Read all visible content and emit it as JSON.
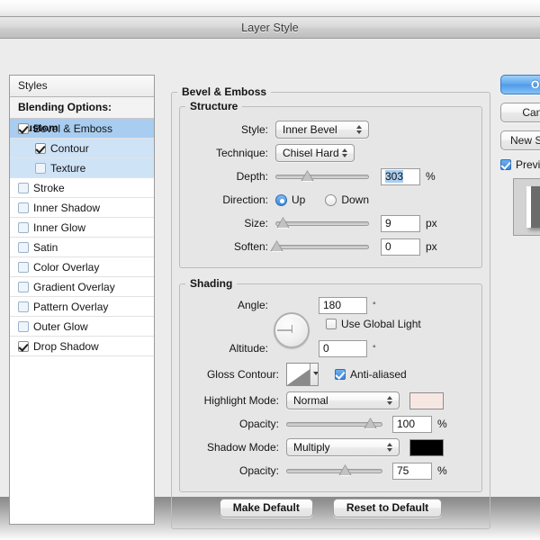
{
  "window": {
    "title": "Layer Style"
  },
  "styles_panel": {
    "header": "Styles",
    "blending_options": "Blending Options: Custom",
    "effects": [
      {
        "label": "Bevel & Emboss",
        "checked": true,
        "selected": true,
        "indent": false
      },
      {
        "label": "Contour",
        "checked": true,
        "selected": false,
        "indent": true
      },
      {
        "label": "Texture",
        "checked": false,
        "selected": false,
        "indent": true
      },
      {
        "label": "Stroke",
        "checked": false,
        "selected": false,
        "indent": false
      },
      {
        "label": "Inner Shadow",
        "checked": false,
        "selected": false,
        "indent": false
      },
      {
        "label": "Inner Glow",
        "checked": false,
        "selected": false,
        "indent": false
      },
      {
        "label": "Satin",
        "checked": false,
        "selected": false,
        "indent": false
      },
      {
        "label": "Color Overlay",
        "checked": false,
        "selected": false,
        "indent": false
      },
      {
        "label": "Gradient Overlay",
        "checked": false,
        "selected": false,
        "indent": false
      },
      {
        "label": "Pattern Overlay",
        "checked": false,
        "selected": false,
        "indent": false
      },
      {
        "label": "Outer Glow",
        "checked": false,
        "selected": false,
        "indent": false
      },
      {
        "label": "Drop Shadow",
        "checked": true,
        "selected": false,
        "indent": false
      }
    ]
  },
  "actions": {
    "ok": "OK",
    "cancel": "Cancel",
    "new_style": "New Style...",
    "preview_label": "Preview",
    "preview_checked": true
  },
  "main": {
    "group_title": "Bevel & Emboss",
    "structure": {
      "title": "Structure",
      "style": {
        "label": "Style:",
        "value": "Inner Bevel"
      },
      "technique": {
        "label": "Technique:",
        "value": "Chisel Hard"
      },
      "depth": {
        "label": "Depth:",
        "value": "303",
        "unit": "%",
        "slider_pct": 35,
        "selected": true
      },
      "direction": {
        "label": "Direction:",
        "up": "Up",
        "down": "Down",
        "value": "Up"
      },
      "size": {
        "label": "Size:",
        "value": "9",
        "unit": "px",
        "slider_pct": 9
      },
      "soften": {
        "label": "Soften:",
        "value": "0",
        "unit": "px",
        "slider_pct": 2
      }
    },
    "shading": {
      "title": "Shading",
      "angle": {
        "label": "Angle:",
        "value": "180",
        "unit": "°"
      },
      "use_global_light": {
        "label": "Use Global Light",
        "checked": false
      },
      "altitude": {
        "label": "Altitude:",
        "value": "0",
        "unit": "°"
      },
      "gloss_contour": {
        "label": "Gloss Contour:"
      },
      "anti_aliased": {
        "label": "Anti-aliased",
        "checked": true
      },
      "highlight_mode": {
        "label": "Highlight Mode:",
        "value": "Normal",
        "color": "#f7e7e2"
      },
      "highlight_opacity": {
        "label": "Opacity:",
        "value": "100",
        "unit": "%",
        "slider_pct": 88
      },
      "shadow_mode": {
        "label": "Shadow Mode:",
        "value": "Multiply",
        "color": "#000000"
      },
      "shadow_opacity": {
        "label": "Opacity:",
        "value": "75",
        "unit": "%",
        "slider_pct": 62
      }
    },
    "make_default": "Make Default",
    "reset_to_default": "Reset to Default"
  }
}
